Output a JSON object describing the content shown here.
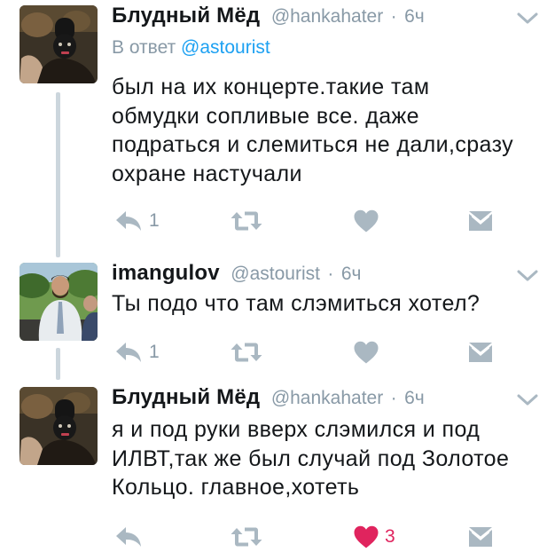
{
  "colors": {
    "text": "#14171a",
    "secondary": "#8899a6",
    "link": "#1da1f2",
    "icon": "#aab8c2",
    "like_active": "#e0245e",
    "thread_line": "#ccd6dd"
  },
  "tweets": [
    {
      "author": "Блудный Мёд",
      "handle": "@hankahater",
      "separator": "·",
      "time": "6ч",
      "reply_prefix": "В ответ ",
      "reply_mention": "@astourist",
      "lines": [
        "был на их концерте.такие там",
        "обмудки сопливые все. даже",
        "подраться и слемиться не дали,сразу",
        "охране настучали"
      ],
      "reply_count": "1",
      "retweet_count": "",
      "like_count": "",
      "liked": false,
      "icons": [
        "reply-icon",
        "retweet-icon",
        "heart-icon",
        "direct-message-icon",
        "chevron-down-icon"
      ]
    },
    {
      "author": "imangulov",
      "handle": "@astourist",
      "separator": "·",
      "time": "6ч",
      "lines": [
        "Ты подо что там слэмиться хотел?"
      ],
      "reply_count": "1",
      "retweet_count": "",
      "like_count": "",
      "liked": false,
      "icons": [
        "reply-icon",
        "retweet-icon",
        "heart-icon",
        "direct-message-icon",
        "chevron-down-icon"
      ]
    },
    {
      "author": "Блудный Мёд",
      "handle": "@hankahater",
      "separator": "·",
      "time": "6ч",
      "lines": [
        "я и под руки вверх слэмился и под",
        "ИЛВТ,так же был случай под Золотое",
        "Кольцо. главное,хотеть"
      ],
      "reply_count": "",
      "retweet_count": "",
      "like_count": "3",
      "liked": true,
      "icons": [
        "reply-icon",
        "retweet-icon",
        "heart-icon",
        "direct-message-icon",
        "chevron-down-icon"
      ]
    }
  ]
}
